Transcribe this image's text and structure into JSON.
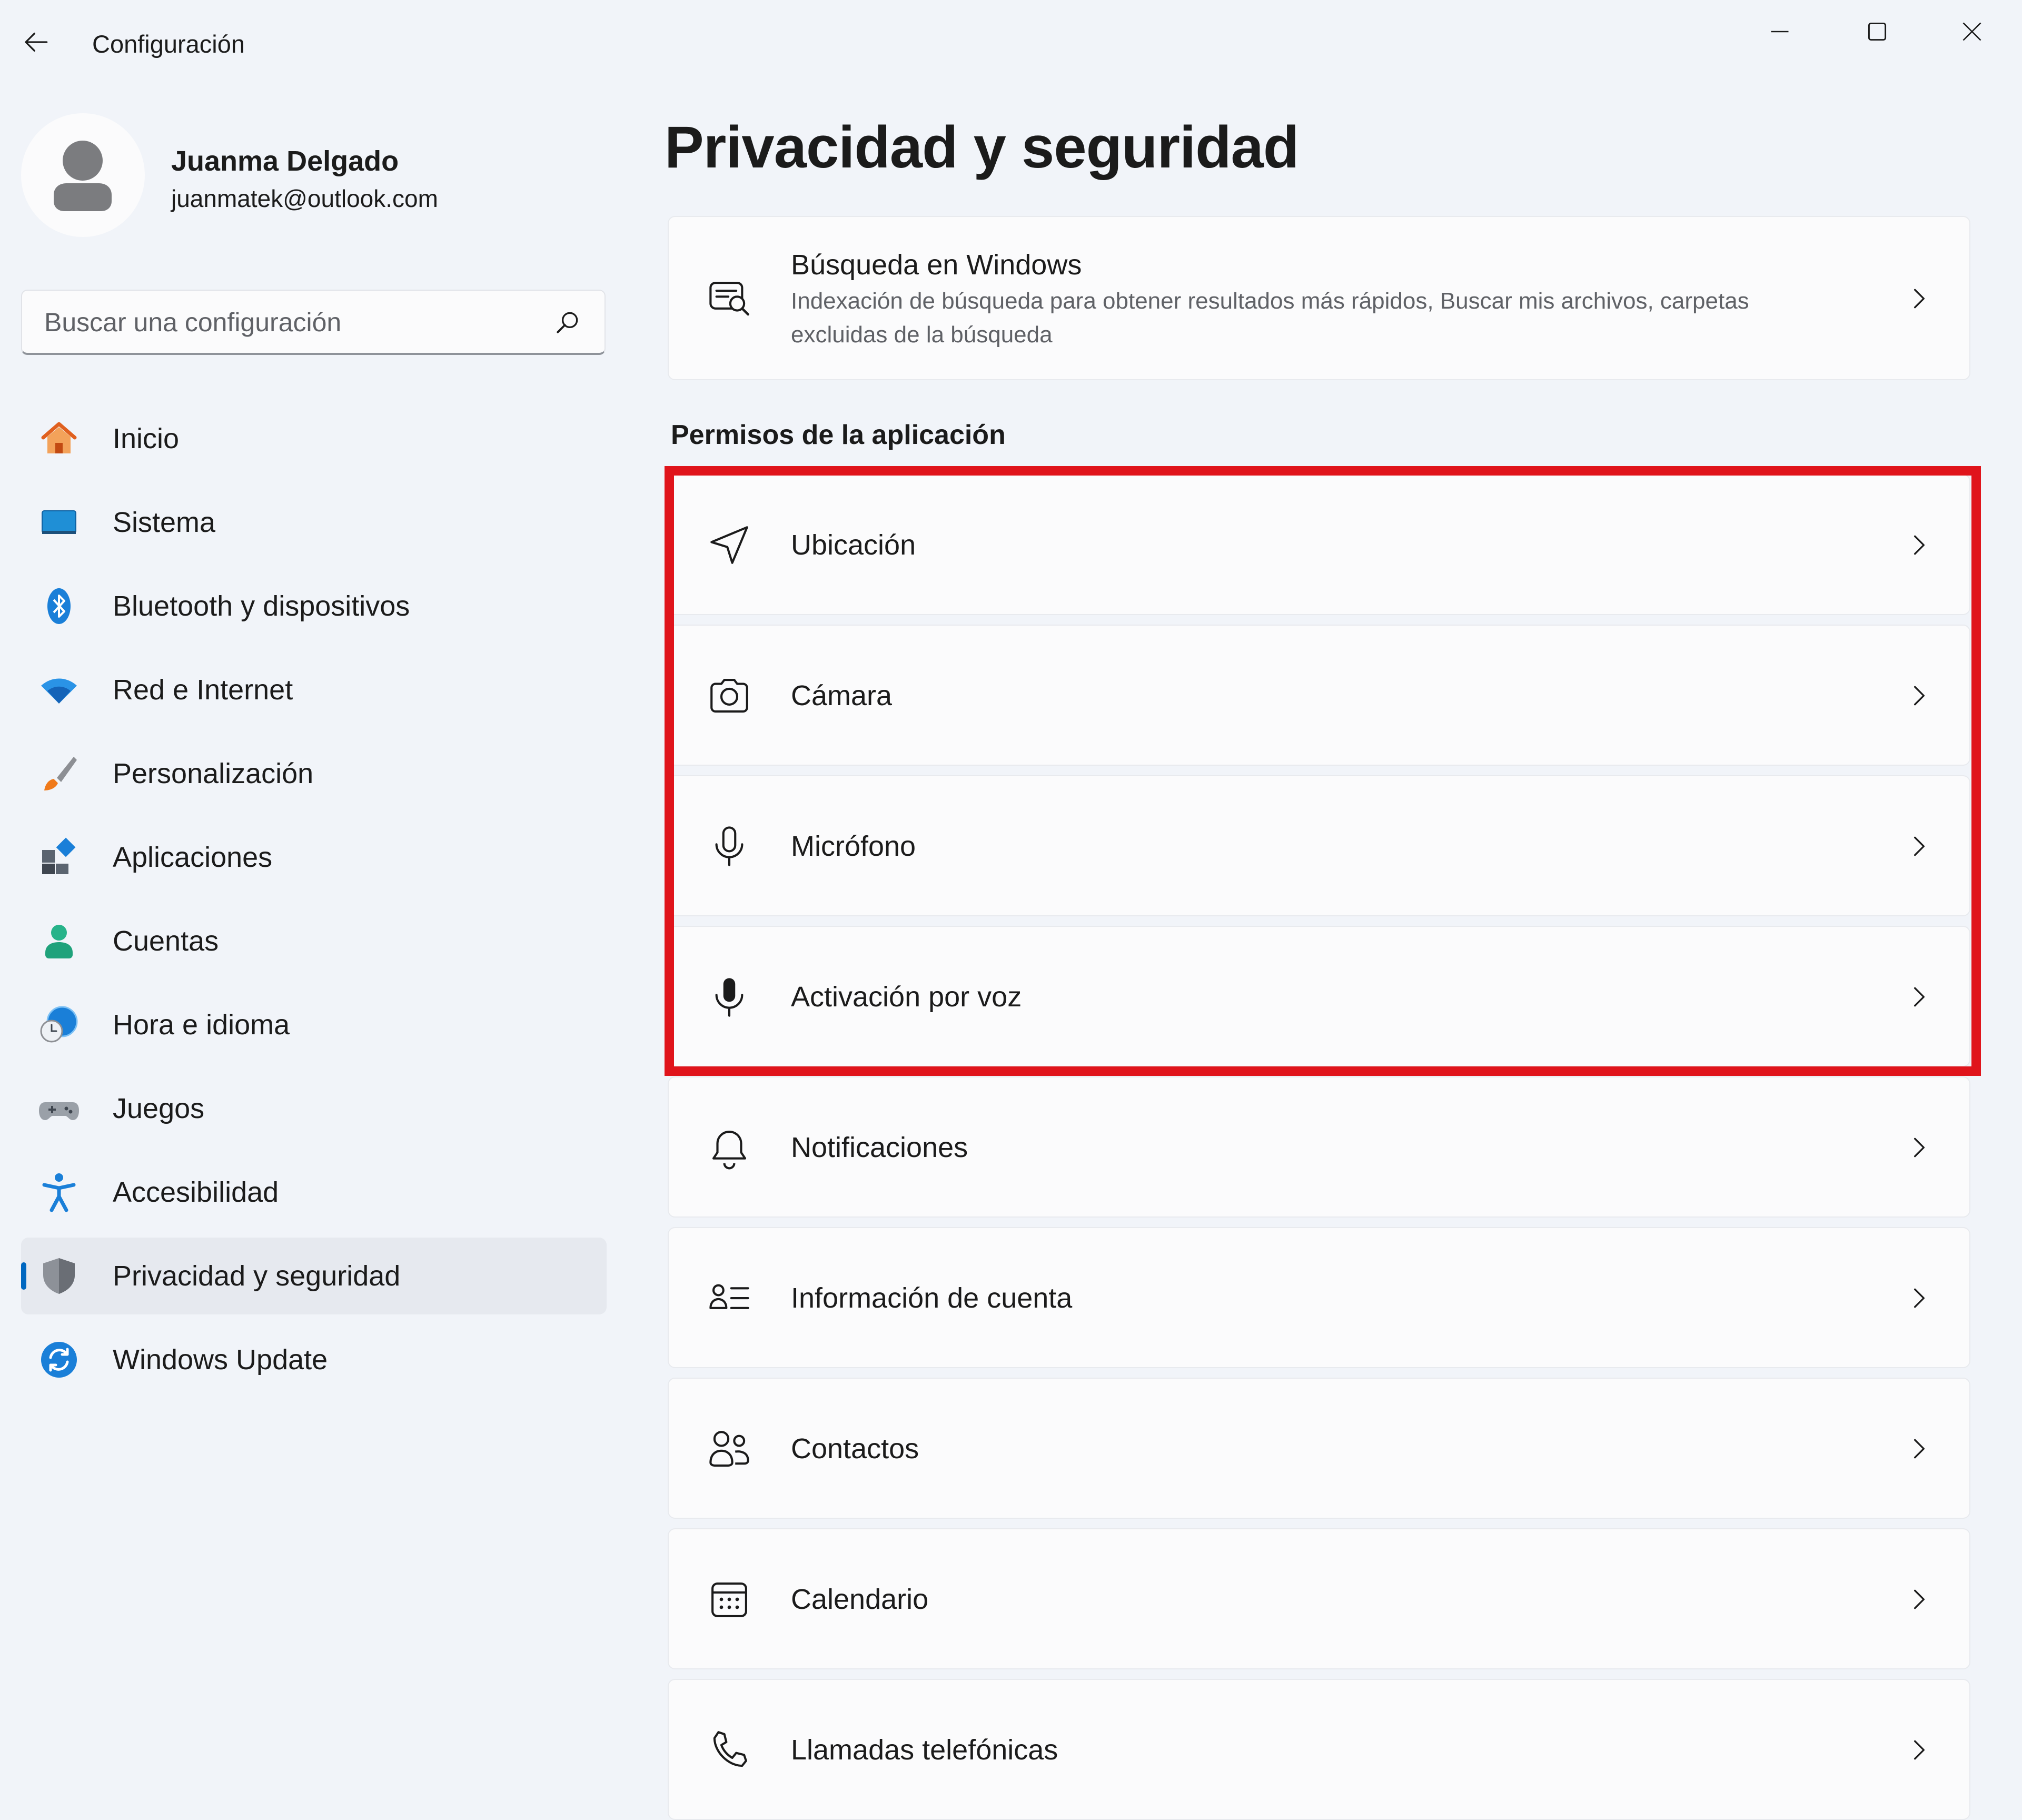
{
  "window": {
    "title": "Configuración",
    "controls": [
      "minimize",
      "maximize",
      "close"
    ]
  },
  "profile": {
    "name": "Juanma Delgado",
    "email": "juanmatek@outlook.com"
  },
  "search": {
    "placeholder": "Buscar una configuración",
    "value": ""
  },
  "sidebar": {
    "selected": "Privacidad y seguridad",
    "items": [
      {
        "label": "Inicio",
        "icon": "home-icon"
      },
      {
        "label": "Sistema",
        "icon": "system-icon"
      },
      {
        "label": "Bluetooth y dispositivos",
        "icon": "bluetooth-icon"
      },
      {
        "label": "Red e Internet",
        "icon": "wifi-icon"
      },
      {
        "label": "Personalización",
        "icon": "brush-icon"
      },
      {
        "label": "Aplicaciones",
        "icon": "apps-icon"
      },
      {
        "label": "Cuentas",
        "icon": "accounts-icon"
      },
      {
        "label": "Hora e idioma",
        "icon": "clock-globe-icon"
      },
      {
        "label": "Juegos",
        "icon": "gamepad-icon"
      },
      {
        "label": "Accesibilidad",
        "icon": "accessibility-icon"
      },
      {
        "label": "Privacidad y seguridad",
        "icon": "shield-icon"
      },
      {
        "label": "Windows Update",
        "icon": "update-icon"
      }
    ]
  },
  "main": {
    "title": "Privacidad y seguridad",
    "search_card": {
      "title": "Búsqueda en Windows",
      "description": "Indexación de búsqueda para obtener resultados más rápidos, Buscar mis archivos, carpetas excluidas de la búsqueda",
      "icon": "search-windows-icon"
    },
    "section_title": "Permisos de la aplicación",
    "permissions": [
      {
        "label": "Ubicación",
        "icon": "location-icon"
      },
      {
        "label": "Cámara",
        "icon": "camera-icon"
      },
      {
        "label": "Micrófono",
        "icon": "microphone-icon"
      },
      {
        "label": "Activación por voz",
        "icon": "voice-activation-icon"
      },
      {
        "label": "Notificaciones",
        "icon": "bell-icon"
      },
      {
        "label": "Información de cuenta",
        "icon": "account-info-icon"
      },
      {
        "label": "Contactos",
        "icon": "contacts-icon"
      },
      {
        "label": "Calendario",
        "icon": "calendar-icon"
      },
      {
        "label": "Llamadas telefónicas",
        "icon": "phone-icon"
      }
    ]
  },
  "colors": {
    "accent": "#0067c0",
    "highlight": "#e0141b",
    "background": "#f1f4f9",
    "card": "#fbfbfc"
  }
}
